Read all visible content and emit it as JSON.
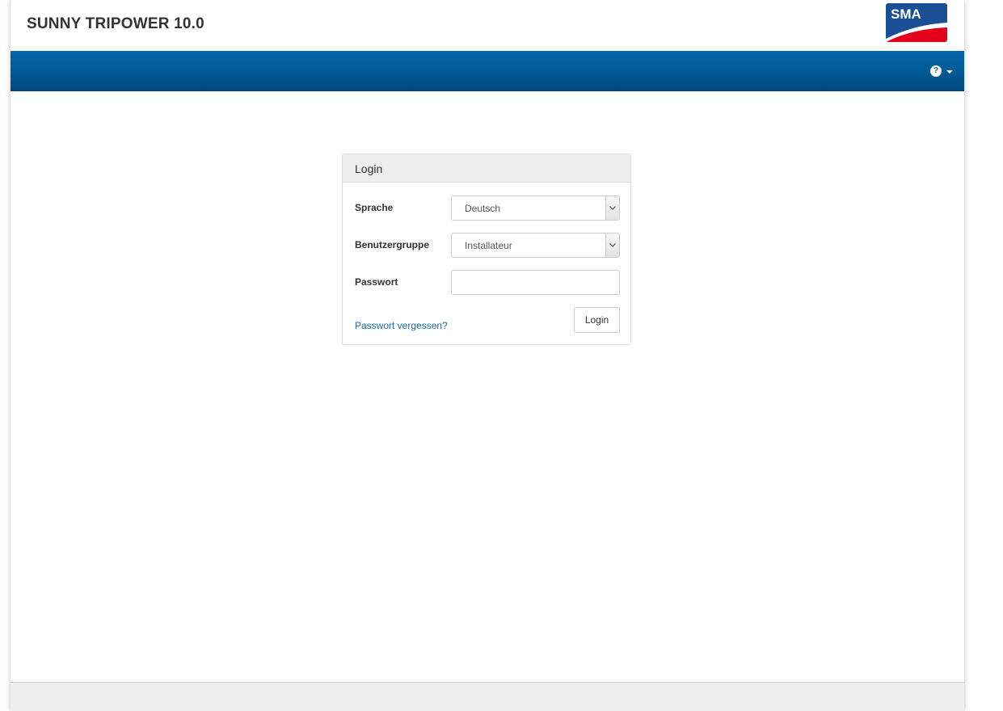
{
  "header": {
    "title": "SUNNY TRIPOWER 10.0",
    "logo_text": "SMA",
    "logo_colors": {
      "blue": "#1a4f95",
      "red": "#e2001a"
    }
  },
  "navbar": {
    "help_icon": "question-circle-icon",
    "help_icon_glyph": "?",
    "colors": {
      "top": "#0467ab",
      "bottom": "#02497d"
    }
  },
  "login_panel": {
    "heading": "Login",
    "language": {
      "label": "Sprache",
      "selected": "Deutsch"
    },
    "user_group": {
      "label": "Benutzergruppe",
      "selected": "Installateur"
    },
    "password": {
      "label": "Passwort",
      "value": ""
    },
    "forgot_link": "Passwort vergessen?",
    "login_button": "Login"
  }
}
